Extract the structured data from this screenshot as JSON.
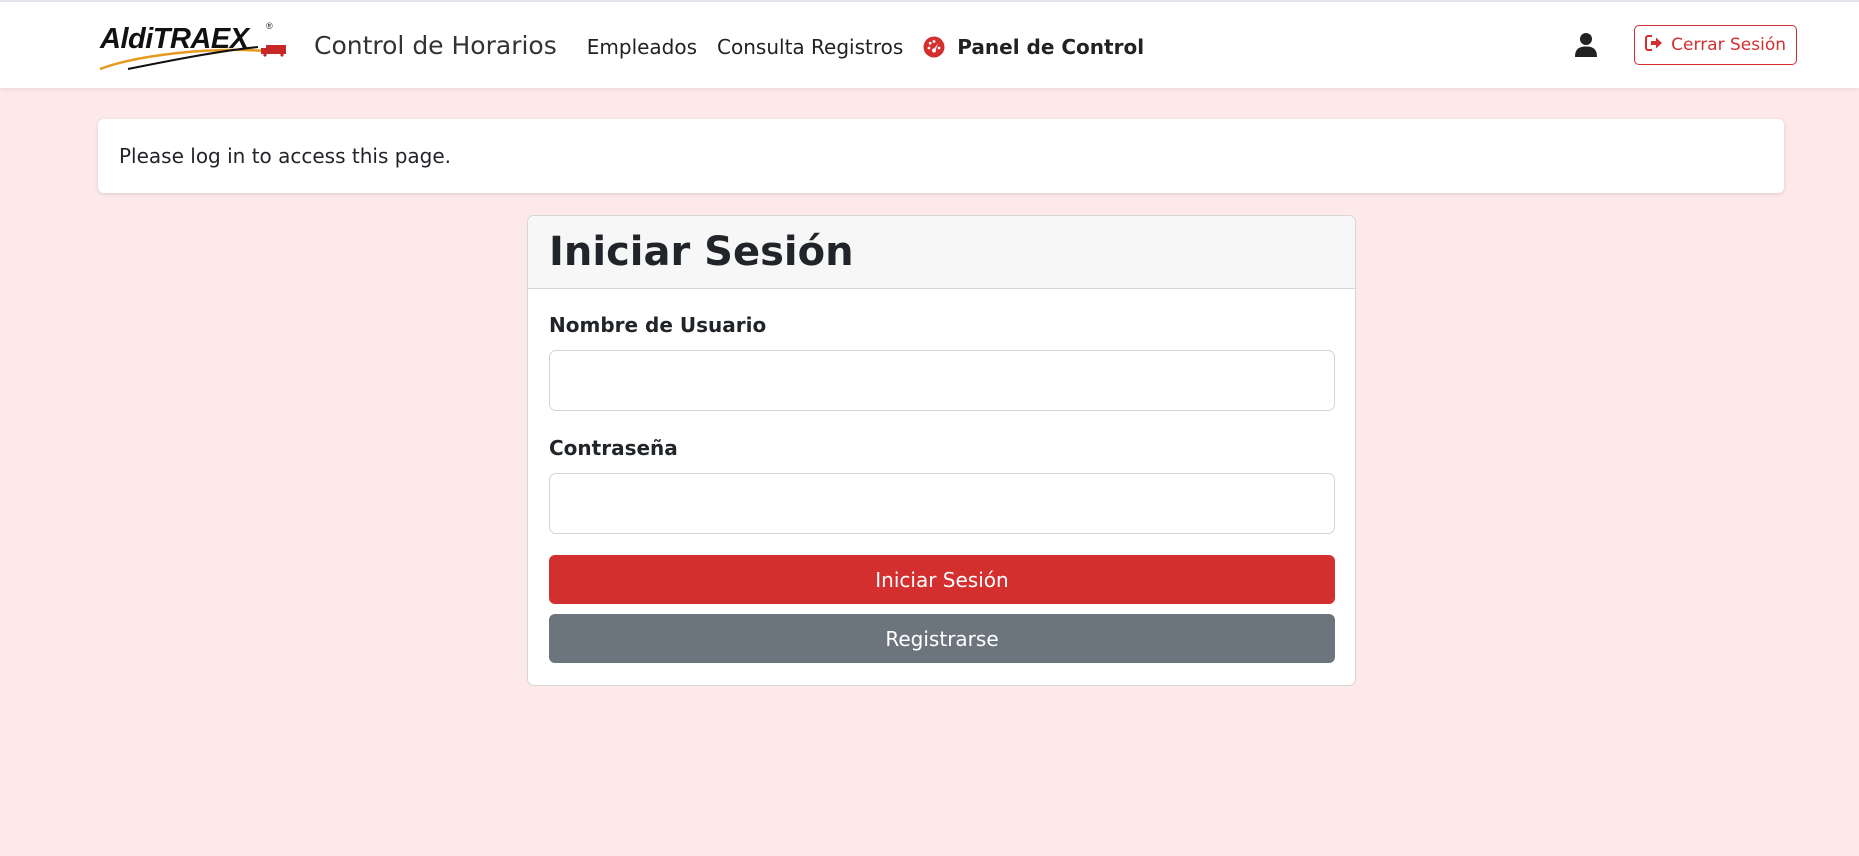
{
  "colors": {
    "accent": "#d32f2f",
    "page_background": "#fde8ea",
    "secondary_button": "#6c757d"
  },
  "navbar": {
    "logo_text": "AldiTRAEX",
    "app_title": "Control de Horarios",
    "links": [
      {
        "label": "Empleados"
      },
      {
        "label": "Consulta Registros"
      },
      {
        "label": "Panel de Control",
        "icon": "gauge-icon"
      }
    ],
    "user_icon": "user-icon",
    "logout_label": "Cerrar Sesión",
    "logout_icon": "sign-out-icon"
  },
  "alert": {
    "message": "Please log in to access this page."
  },
  "login_card": {
    "title": "Iniciar Sesión",
    "username_label": "Nombre de Usuario",
    "username_value": "",
    "password_label": "Contraseña",
    "password_value": "",
    "submit_label": "Iniciar Sesión",
    "register_label": "Registrarse"
  }
}
